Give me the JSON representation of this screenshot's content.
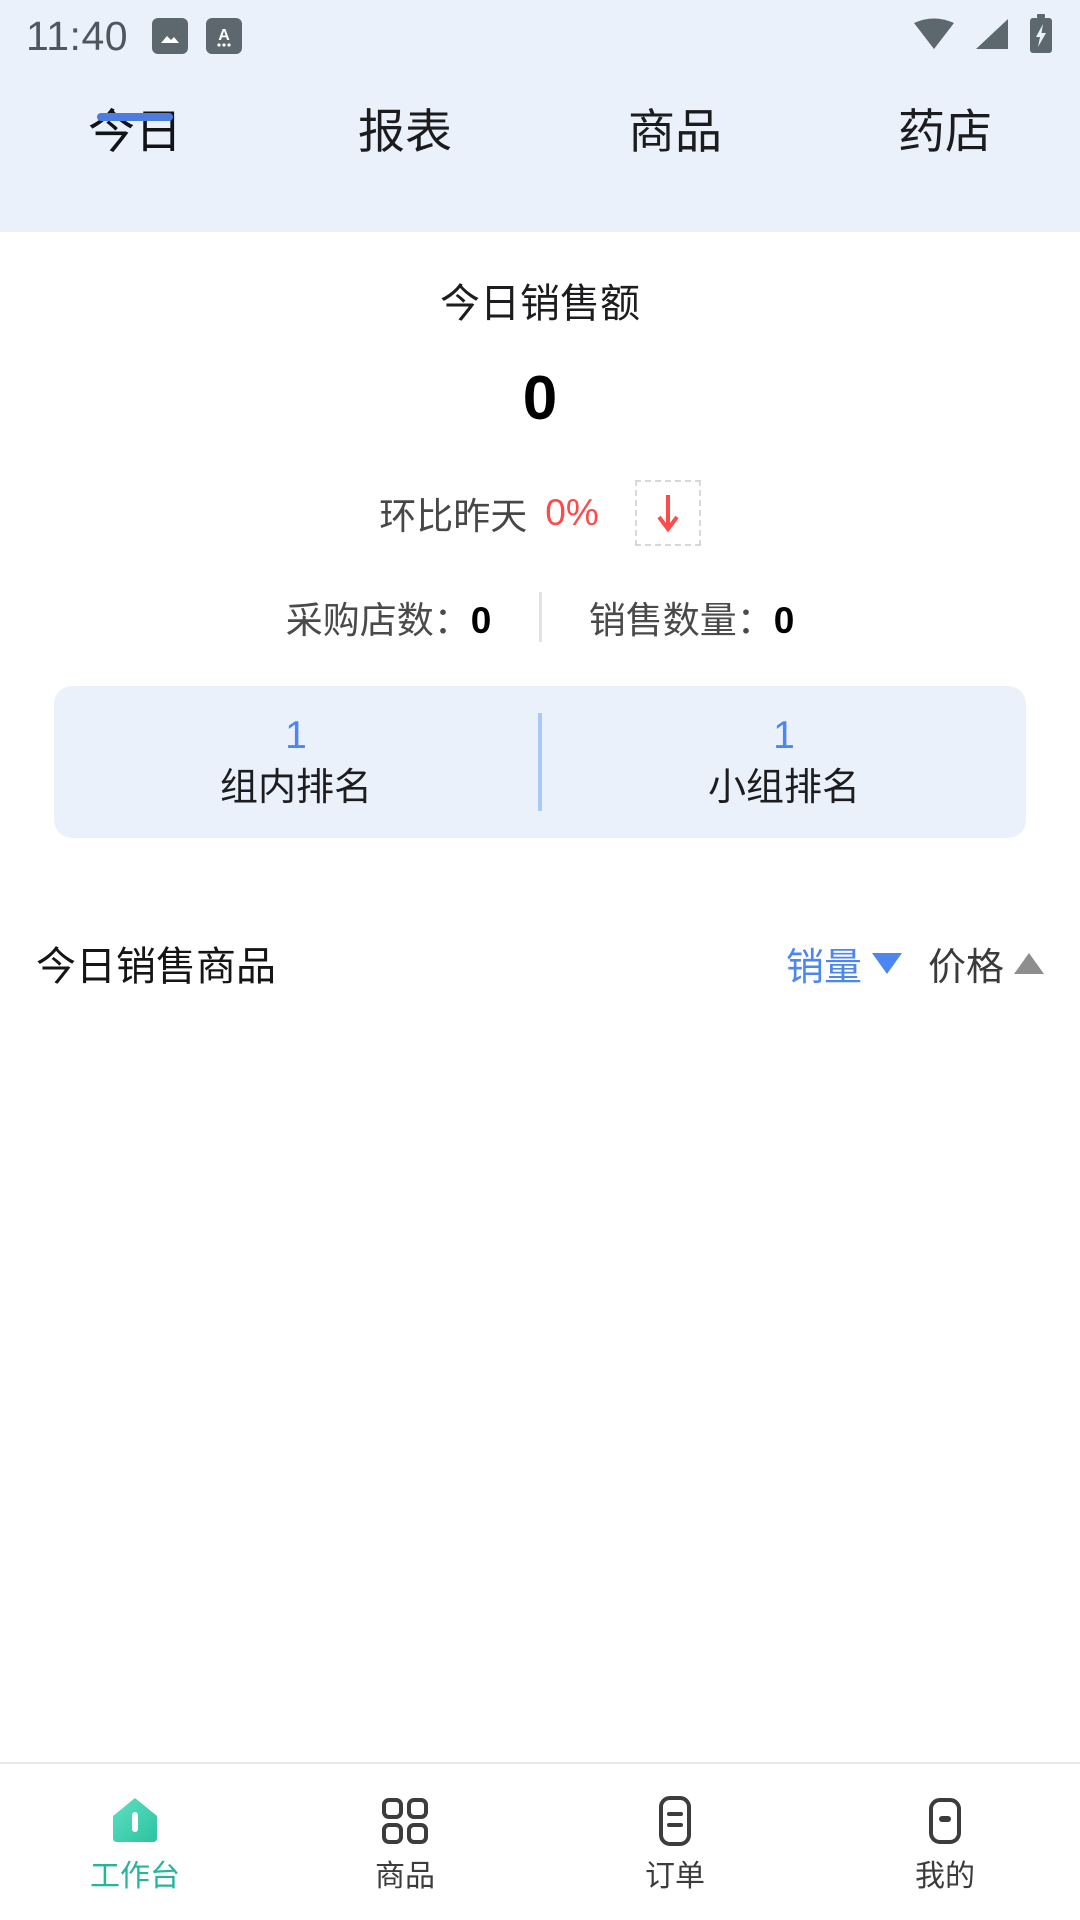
{
  "statusbar": {
    "time": "11:40",
    "left_icons": [
      "image-icon",
      "app-a-icon"
    ],
    "right_icons": [
      "wifi-icon",
      "signal-icon",
      "battery-charging-icon"
    ]
  },
  "tabs": [
    {
      "label": "今日",
      "active": true
    },
    {
      "label": "报表",
      "active": false
    },
    {
      "label": "商品",
      "active": false
    },
    {
      "label": "药店",
      "active": false
    }
  ],
  "sales": {
    "title": "今日销售额",
    "amount": "0",
    "compare_label": "环比昨天",
    "compare_value": "0%",
    "trend_icon": "arrow-down-icon"
  },
  "stats": [
    {
      "label": "采购店数：",
      "value": "0"
    },
    {
      "label": "销售数量：",
      "value": "0"
    }
  ],
  "ranking": [
    {
      "value": "1",
      "label": "组内排名"
    },
    {
      "value": "1",
      "label": "小组排名"
    }
  ],
  "section": {
    "title": "今日销售商品",
    "sorts": [
      {
        "label": "销量",
        "arrow": "▼",
        "active": true
      },
      {
        "label": "价格",
        "arrow": "▲",
        "active": false
      }
    ]
  },
  "bottom_nav": [
    {
      "label": "工作台",
      "icon": "workbench-home-icon",
      "active": true
    },
    {
      "label": "商品",
      "icon": "grid-icon",
      "active": false
    },
    {
      "label": "订单",
      "icon": "order-list-icon",
      "active": false
    },
    {
      "label": "我的",
      "icon": "profile-icon",
      "active": false
    }
  ],
  "colors": {
    "accent_blue": "#4c86f0",
    "tab_indicator": "#4c7ce0",
    "header_bg": "#eaf1fb",
    "danger_red": "#fd4b4b",
    "nav_active_green": "#27b49a"
  }
}
